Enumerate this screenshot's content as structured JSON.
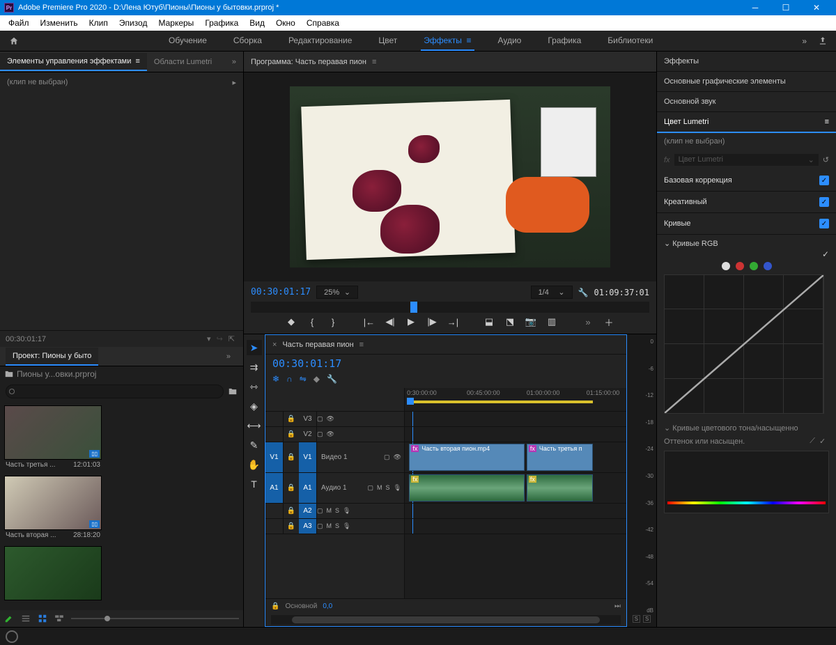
{
  "titlebar": {
    "app": "Adobe Premiere Pro 2020",
    "path": "D:\\Лена Ютуб\\Пионы\\Пионы у бытовки.prproj *"
  },
  "menu": [
    "Файл",
    "Изменить",
    "Клип",
    "Эпизод",
    "Маркеры",
    "Графика",
    "Вид",
    "Окно",
    "Справка"
  ],
  "workspaces": [
    "Обучение",
    "Сборка",
    "Редактирование",
    "Цвет",
    "Эффекты",
    "Аудио",
    "Графика",
    "Библиотеки"
  ],
  "active_workspace": "Эффекты",
  "fx_panel": {
    "tab1": "Элементы управления эффектами",
    "tab2": "Области Lumetri",
    "noclip": "(клип не выбран)"
  },
  "timecode_left": "00:30:01:17",
  "project": {
    "tab": "Проект: Пионы у быто",
    "crumb": "Пионы у...овки.prproj",
    "search_ph": "",
    "items": [
      {
        "name": "Часть третья ...",
        "dur": "12:01:03"
      },
      {
        "name": "Часть вторая ...",
        "dur": "28:18:20"
      },
      {
        "name": "",
        "dur": ""
      }
    ]
  },
  "program": {
    "title": "Программа: Часть перавая пион",
    "tc": "00:30:01:17",
    "zoom": "25%",
    "res": "1/4",
    "dur": "01:09:37:01"
  },
  "timeline": {
    "seq_name": "Часть перавая пион",
    "tc": "00:30:01:17",
    "ruler": [
      "0:30:00:00",
      "00:45:00:00",
      "01:00:00:00",
      "01:15:00:00"
    ],
    "tracks": {
      "v3": "V3",
      "v2": "V2",
      "v1": "V1",
      "v1label": "Видео 1",
      "a1": "A1",
      "a1label": "Аудио 1",
      "a2": "A2",
      "a3": "A3"
    },
    "clips": {
      "c1": "Часть вторая пион.mp4",
      "c2": "Часть третья п"
    },
    "footer_label": "Основной",
    "footer_val": "0,0"
  },
  "meter": {
    "marks": [
      "0",
      "-6",
      "-12",
      "-18",
      "-24",
      "-30",
      "-36",
      "-42",
      "-48",
      "-54"
    ],
    "unit": "dB",
    "solo": "S"
  },
  "lumetri": {
    "tabs": [
      "Эффекты",
      "Основные графические элементы",
      "Основной звук",
      "Цвет Lumetri"
    ],
    "noclip": "(клип не выбран)",
    "preset": "Цвет Lumetri",
    "sections": {
      "basic": "Базовая коррекция",
      "creative": "Креативный",
      "curves": "Кривые",
      "rgb": "Кривые RGB",
      "hue": "Кривые цветового тона/насыщенно",
      "hue_sub": "Оттенок или насыщен."
    }
  },
  "fx_label": "fx"
}
